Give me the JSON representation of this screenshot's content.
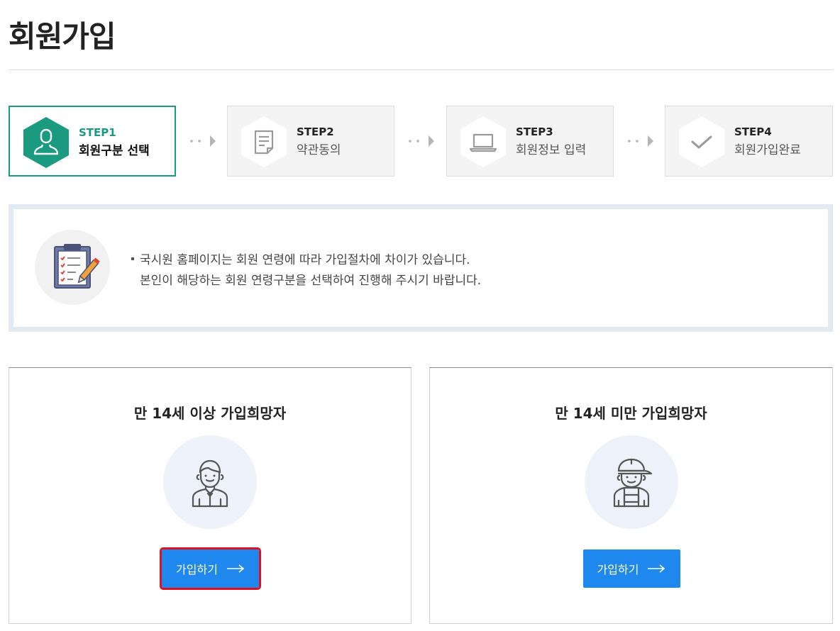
{
  "header": {
    "title": "회원가입"
  },
  "steps": [
    {
      "num": "STEP1",
      "label": "회원구분 선택",
      "icon": "user-icon",
      "active": true
    },
    {
      "num": "STEP2",
      "label": "약관동의",
      "icon": "document-icon",
      "active": false
    },
    {
      "num": "STEP3",
      "label": "회원정보 입력",
      "icon": "laptop-icon",
      "active": false
    },
    {
      "num": "STEP4",
      "label": "회원가입완료",
      "icon": "check-icon",
      "active": false
    }
  ],
  "info": {
    "icon": "clipboard-icon",
    "line1": "국시원 홈페이지는 회원 연령에 따라 가입절차에 차이가 있습니다.",
    "line2": "본인이 해당하는 회원 연령구분을 선택하여 진행해 주시기 바랍니다."
  },
  "cards": [
    {
      "title": "만 14세 이상 가입희망자",
      "button": "가입하기",
      "icon": "adult-icon"
    },
    {
      "title": "만 14세 미만 가입희망자",
      "button": "가입하기",
      "icon": "child-icon"
    }
  ],
  "colors": {
    "accent": "#1a9a7e",
    "button": "#1e88ee",
    "info_border": "#e1e9f1",
    "highlight": "#e0101e"
  }
}
